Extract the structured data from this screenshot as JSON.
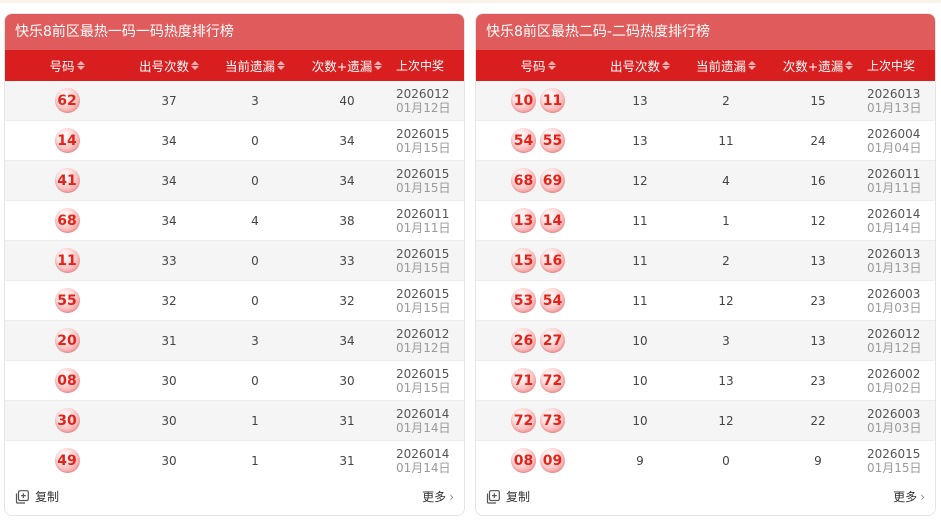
{
  "panels": [
    {
      "title": "快乐8前区最热一码一码热度排行榜",
      "headers": [
        "号码",
        "出号次数",
        "当前遗漏",
        "次数+遗漏",
        "上次中奖"
      ],
      "rows": [
        {
          "balls": [
            "62"
          ],
          "count": "37",
          "miss": "3",
          "sum": "40",
          "issue": "2026012",
          "date": "01月12日"
        },
        {
          "balls": [
            "14"
          ],
          "count": "34",
          "miss": "0",
          "sum": "34",
          "issue": "2026015",
          "date": "01月15日"
        },
        {
          "balls": [
            "41"
          ],
          "count": "34",
          "miss": "0",
          "sum": "34",
          "issue": "2026015",
          "date": "01月15日"
        },
        {
          "balls": [
            "68"
          ],
          "count": "34",
          "miss": "4",
          "sum": "38",
          "issue": "2026011",
          "date": "01月11日"
        },
        {
          "balls": [
            "11"
          ],
          "count": "33",
          "miss": "0",
          "sum": "33",
          "issue": "2026015",
          "date": "01月15日"
        },
        {
          "balls": [
            "55"
          ],
          "count": "32",
          "miss": "0",
          "sum": "32",
          "issue": "2026015",
          "date": "01月15日"
        },
        {
          "balls": [
            "20"
          ],
          "count": "31",
          "miss": "3",
          "sum": "34",
          "issue": "2026012",
          "date": "01月12日"
        },
        {
          "balls": [
            "08"
          ],
          "count": "30",
          "miss": "0",
          "sum": "30",
          "issue": "2026015",
          "date": "01月15日"
        },
        {
          "balls": [
            "30"
          ],
          "count": "30",
          "miss": "1",
          "sum": "31",
          "issue": "2026014",
          "date": "01月14日"
        },
        {
          "balls": [
            "49"
          ],
          "count": "30",
          "miss": "1",
          "sum": "31",
          "issue": "2026014",
          "date": "01月14日"
        }
      ],
      "copy_label": "复制",
      "more_label": "更多"
    },
    {
      "title": "快乐8前区最热二码-二码热度排行榜",
      "headers": [
        "号码",
        "出号次数",
        "当前遗漏",
        "次数+遗漏",
        "上次中奖"
      ],
      "rows": [
        {
          "balls": [
            "10",
            "11"
          ],
          "count": "13",
          "miss": "2",
          "sum": "15",
          "issue": "2026013",
          "date": "01月13日"
        },
        {
          "balls": [
            "54",
            "55"
          ],
          "count": "13",
          "miss": "11",
          "sum": "24",
          "issue": "2026004",
          "date": "01月04日"
        },
        {
          "balls": [
            "68",
            "69"
          ],
          "count": "12",
          "miss": "4",
          "sum": "16",
          "issue": "2026011",
          "date": "01月11日"
        },
        {
          "balls": [
            "13",
            "14"
          ],
          "count": "11",
          "miss": "1",
          "sum": "12",
          "issue": "2026014",
          "date": "01月14日"
        },
        {
          "balls": [
            "15",
            "16"
          ],
          "count": "11",
          "miss": "2",
          "sum": "13",
          "issue": "2026013",
          "date": "01月13日"
        },
        {
          "balls": [
            "53",
            "54"
          ],
          "count": "11",
          "miss": "12",
          "sum": "23",
          "issue": "2026003",
          "date": "01月03日"
        },
        {
          "balls": [
            "26",
            "27"
          ],
          "count": "10",
          "miss": "3",
          "sum": "13",
          "issue": "2026012",
          "date": "01月12日"
        },
        {
          "balls": [
            "71",
            "72"
          ],
          "count": "10",
          "miss": "13",
          "sum": "23",
          "issue": "2026002",
          "date": "01月02日"
        },
        {
          "balls": [
            "72",
            "73"
          ],
          "count": "10",
          "miss": "12",
          "sum": "22",
          "issue": "2026003",
          "date": "01月03日"
        },
        {
          "balls": [
            "08",
            "09"
          ],
          "count": "9",
          "miss": "0",
          "sum": "9",
          "issue": "2026015",
          "date": "01月15日"
        }
      ],
      "copy_label": "复制",
      "more_label": "更多"
    }
  ],
  "icons": {
    "copy": "copy-icon",
    "more": "chevron-right-icon",
    "sort": "sort-icon"
  },
  "colors": {
    "header_red": "#d81e1e",
    "title_red": "#e05b5b",
    "ball_text": "#e2231a"
  }
}
